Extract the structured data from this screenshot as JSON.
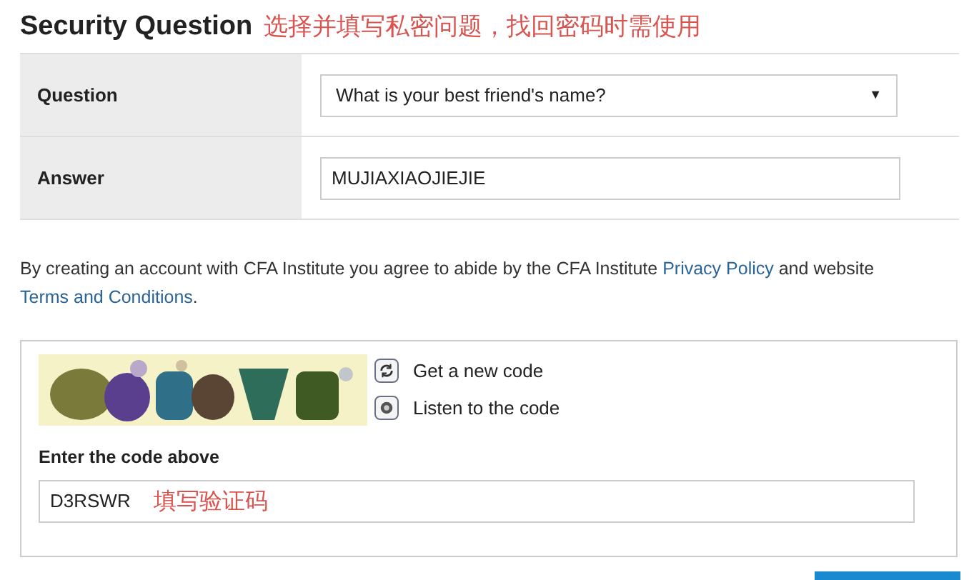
{
  "heading": {
    "title": "Security Question",
    "note": "选择并填写私密问题，找回密码时需使用"
  },
  "form": [
    {
      "kind": "select",
      "label": "Question",
      "value": "What is your best friend's name?",
      "caret": "▼"
    },
    {
      "kind": "text",
      "label": "Answer",
      "value": "MUJIAXIAOJIEJIE"
    }
  ],
  "agreement": {
    "text": "By creating an account with CFA Institute you agree to abide by the CFA Institute",
    "privacy_link": "Privacy Policy",
    "middle": "and website",
    "terms_link": "Terms and Conditions",
    "end": "."
  },
  "captcha": {
    "actions": [
      {
        "kind": "refresh",
        "label": "Get a new code"
      },
      {
        "kind": "audio",
        "label": "Listen to the code"
      }
    ],
    "label": "Enter the code above",
    "value": "D3RSWR",
    "note": "填写验证码"
  }
}
